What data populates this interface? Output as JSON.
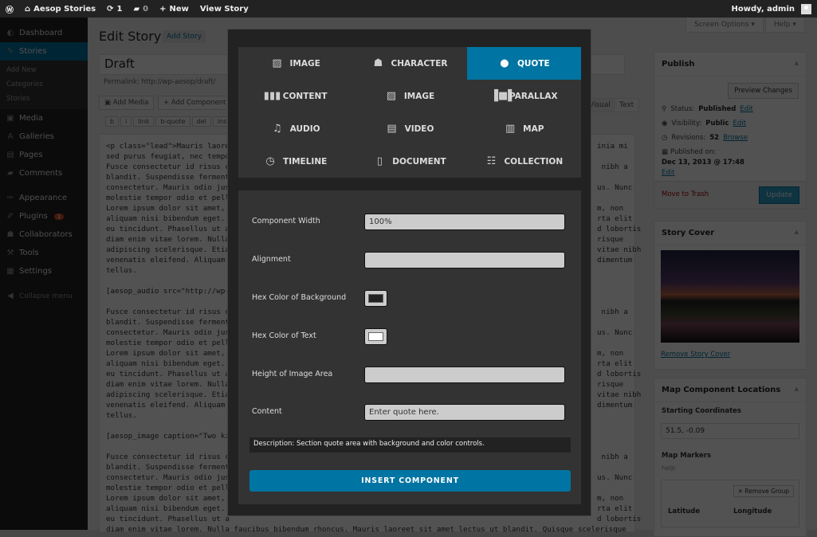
{
  "adminbar": {
    "site": "Aesop Stories",
    "updates": "1",
    "comments": "0",
    "new": "New",
    "view": "View Story",
    "howdy": "Howdy, admin"
  },
  "sidebar": {
    "items": [
      {
        "label": "Dashboard",
        "icon": "◐"
      },
      {
        "label": "Stories",
        "icon": "✎"
      },
      {
        "label": "Media",
        "icon": "▣"
      },
      {
        "label": "Galleries",
        "icon": "A"
      },
      {
        "label": "Pages",
        "icon": "▤"
      },
      {
        "label": "Comments",
        "icon": "▰"
      },
      {
        "label": "Appearance",
        "icon": "✑"
      },
      {
        "label": "Plugins",
        "icon": "✐",
        "badge": "1"
      },
      {
        "label": "Collaborators",
        "icon": "☗"
      },
      {
        "label": "Tools",
        "icon": "⚒"
      },
      {
        "label": "Settings",
        "icon": "▦"
      },
      {
        "label": "Collapse menu",
        "icon": "◀"
      }
    ],
    "submenu": [
      "Add New",
      "Categories",
      "Stories"
    ]
  },
  "main": {
    "title": "Edit Story",
    "add_story": "Add Story",
    "screen_options": "Screen Options ▾",
    "help": "Help ▾",
    "post_title": "Draft",
    "permalink": "Permalink: http://wp-aesop/draft/",
    "add_media": "Add Media",
    "add_component": "+ Add Component",
    "quicktags": [
      "b",
      "i",
      "link",
      "b-quote",
      "del",
      "ins",
      "img"
    ],
    "tab_visual": "Visual",
    "tab_text": "Text"
  },
  "editor_lines": [
    {
      "l": "<p class=\"lead\">Mauris laore",
      "r": "inia mi"
    },
    {
      "l": "sed purus feugiat, nec tempo",
      "r": ""
    },
    {
      "l": "Fusce consectetur id risus c",
      "r": " nibh a"
    },
    {
      "l": "blandit. Suspendisse ferment",
      "r": ""
    },
    {
      "l": "consectetur. Mauris odio jus",
      "r": "us. Nunc"
    },
    {
      "l": "molestie tempor odio et pell",
      "r": ""
    },
    {
      "l": "Lorem ipsum dolor sit amet,",
      "r": "m, non"
    },
    {
      "l": "aliquam nisi bibendum eget.",
      "r": "rta elit"
    },
    {
      "l": "eu tincidunt. Phasellus ut a",
      "r": "d lobortis"
    },
    {
      "l": "diam enim vitae lorem. Nulla",
      "r": "risque"
    },
    {
      "l": "adipiscing scelerisque. Etia",
      "r": "vitae nibh"
    },
    {
      "l": "venenatis eleifend. Aliquam",
      "r": "dimentum"
    },
    {
      "l": "tellus.",
      "r": ""
    },
    {
      "l": "",
      "r": ""
    },
    {
      "l": "[aesop_audio src=\"http://wp-",
      "r": ""
    },
    {
      "l": "",
      "r": ""
    },
    {
      "l": "Fusce consectetur id risus c",
      "r": " nibh a"
    },
    {
      "l": "blandit. Suspendisse ferment",
      "r": ""
    },
    {
      "l": "consectetur. Mauris odio jus",
      "r": "us. Nunc"
    },
    {
      "l": "molestie tempor odio et pell",
      "r": ""
    },
    {
      "l": "Lorem ipsum dolor sit amet,",
      "r": "m, non"
    },
    {
      "l": "aliquam nisi bibendum eget.",
      "r": "rta elit"
    },
    {
      "l": "eu tincidunt. Phasellus ut a",
      "r": "d lobortis"
    },
    {
      "l": "diam enim vitae lorem. Nulla",
      "r": "risque"
    },
    {
      "l": "adipiscing scelerisque. Etia",
      "r": "vitae nibh"
    },
    {
      "l": "venenatis eleifend. Aliquam",
      "r": "dimentum"
    },
    {
      "l": "tellus.",
      "r": ""
    },
    {
      "l": "",
      "r": ""
    },
    {
      "l": "[aesop_image caption=\"Two ki",
      "r": ""
    },
    {
      "l": "",
      "r": ""
    },
    {
      "l": "Fusce consectetur id risus c",
      "r": " nibh a"
    },
    {
      "l": "blandit. Suspendisse ferment",
      "r": ""
    },
    {
      "l": "consectetur. Mauris odio jus",
      "r": "us. Nunc"
    },
    {
      "l": "molestie tempor odio et pell",
      "r": ""
    },
    {
      "l": "Lorem ipsum dolor sit amet,",
      "r": "m, non"
    },
    {
      "l": "aliquam nisi bibendum eget.",
      "r": "rta elit"
    },
    {
      "l": "eu tincidunt. Phasellus ut a",
      "r": "d lobortis"
    },
    {
      "l": "diam enim vitae lorem. Nulla faucibus bibendum rhoncus. Mauris laoreet sit amet lectus ut blandit. Quisque scelerisque",
      "r": ""
    }
  ],
  "publish": {
    "title": "Publish",
    "preview": "Preview Changes",
    "status_label": "Status:",
    "status": "Published",
    "visibility_label": "Visibility:",
    "visibility": "Public",
    "revisions_label": "Revisions:",
    "revisions": "52",
    "browse": "Browse",
    "published_label": "Published on:",
    "published": "Dec 13, 2013 @ 17:48",
    "edit": "Edit",
    "trash": "Move to Trash",
    "update": "Update"
  },
  "cover": {
    "title": "Story Cover",
    "remove": "Remove Story Cover"
  },
  "map": {
    "title": "Map Component Locations",
    "start_label": "Starting Coordinates",
    "start_value": "51.5, -0.09",
    "markers": "Map Markers",
    "help": "help",
    "remove_group": "✕ Remove Group",
    "lat": "Latitude",
    "lng": "Longitude"
  },
  "modal": {
    "components": [
      {
        "label": "IMAGE",
        "icon": "▨"
      },
      {
        "label": "CHARACTER",
        "icon": "☗"
      },
      {
        "label": "QUOTE",
        "icon": "●",
        "selected": true
      },
      {
        "label": "CONTENT",
        "icon": "▮▮▮"
      },
      {
        "label": "IMAGE",
        "icon": "▨"
      },
      {
        "label": "PARALLAX",
        "icon": "▐■▌"
      },
      {
        "label": "AUDIO",
        "icon": "♫"
      },
      {
        "label": "VIDEO",
        "icon": "▤"
      },
      {
        "label": "MAP",
        "icon": "▥"
      },
      {
        "label": "TIMELINE",
        "icon": "◷"
      },
      {
        "label": "DOCUMENT",
        "icon": "▯"
      },
      {
        "label": "COLLECTION",
        "icon": "☷"
      }
    ],
    "fields": {
      "width_label": "Component Width",
      "width_value": "100%",
      "align_label": "Alignment",
      "align_value": "",
      "bg_label": "Hex Color of Background",
      "bg_color": "#222222",
      "text_label": "Hex Color of Text",
      "text_color": "#ffffff",
      "height_label": "Height of Image Area",
      "height_value": "",
      "content_label": "Content",
      "content_value": "Enter quote here."
    },
    "description": "Description:  Section quote area with background and color controls.",
    "insert": "INSERT COMPONENT",
    "accent": "#0074a2"
  }
}
